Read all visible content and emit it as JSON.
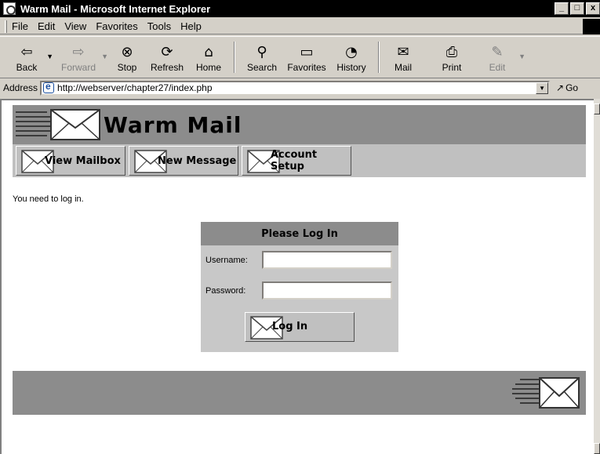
{
  "window": {
    "title": "Warm Mail - Microsoft Internet Explorer",
    "controls": [
      "_",
      "□",
      "x"
    ]
  },
  "menu": {
    "items": [
      {
        "label": "File"
      },
      {
        "label": "Edit"
      },
      {
        "label": "View"
      },
      {
        "label": "Favorites"
      },
      {
        "label": "Tools"
      },
      {
        "label": "Help"
      }
    ]
  },
  "toolbar": {
    "back": "Back",
    "forward": "Forward",
    "stop": "Stop",
    "refresh": "Refresh",
    "home": "Home",
    "search": "Search",
    "favorites": "Favorites",
    "history": "History",
    "mail": "Mail",
    "print": "Print",
    "edit": "Edit"
  },
  "address": {
    "label": "Address",
    "url": "http://webserver/chapter27/index.php",
    "go": "Go"
  },
  "site": {
    "title": "Warm Mail",
    "nav": [
      {
        "label": "View Mailbox"
      },
      {
        "label": "New Message"
      },
      {
        "label": "Account Setup"
      }
    ],
    "message": "You need to log in.",
    "login": {
      "heading": "Please Log In",
      "username_label": "Username:",
      "username_value": "",
      "password_label": "Password:",
      "password_value": "",
      "button": "Log In"
    }
  }
}
